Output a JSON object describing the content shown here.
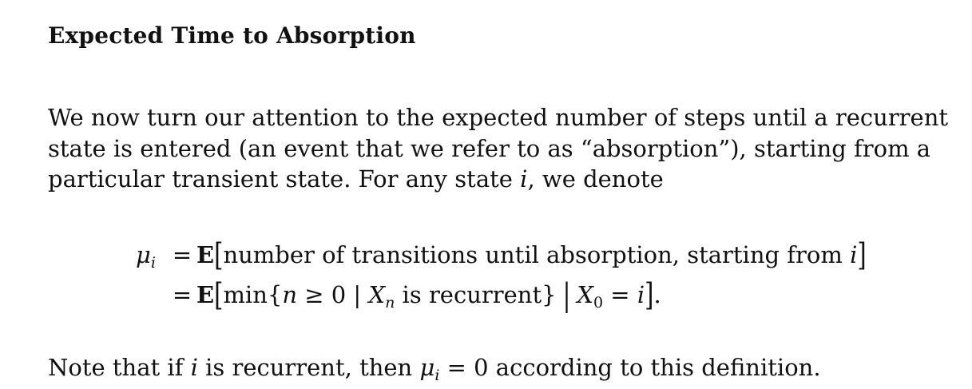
{
  "section": {
    "title": "Expected Time to Absorption"
  },
  "paragraph": {
    "line1": "We now turn our attention to the expected number of steps until a recurrent",
    "line2": "state is entered (an event that we refer to as “absorption”), starting from a",
    "line3_prefix": "particular transient state. For any state ",
    "line3_var": "i",
    "line3_suffix": ", we denote"
  },
  "equation": {
    "lhs_symbol": "μ",
    "lhs_sub": "i",
    "eq_sign": "=",
    "expectation": "E",
    "row1_text": "number of transitions until absorption, starting from ",
    "row1_var": "i",
    "row2_min": "min{",
    "row2_n": "n",
    "row2_geq": " ≥ 0 | ",
    "row2_X": "X",
    "row2_Xsub": "n",
    "row2_mid": " is recurrent}",
    "row2_X0": "X",
    "row2_X0sub": "0",
    "row2_eq": " = ",
    "row2_var": "i",
    "row2_end": "."
  },
  "note": {
    "prefix": "Note that if ",
    "var": "i",
    "mid": " is recurrent, then ",
    "mu": "μ",
    "mu_sub": "i",
    "eq": " = 0 according to this definition."
  }
}
